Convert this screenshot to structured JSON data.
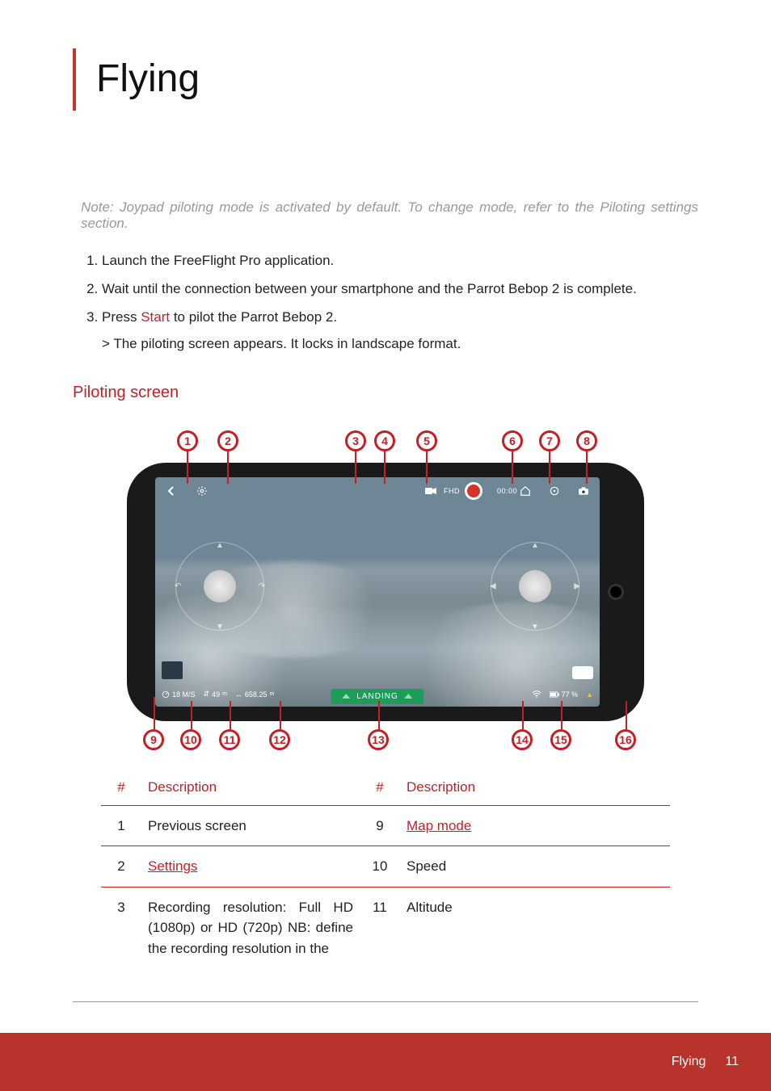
{
  "title": "Flying",
  "note": "Note: Joypad piloting mode is activated by default. To change mode, refer to the Piloting settings section.",
  "steps": {
    "s1": "Launch the FreeFlight Pro application.",
    "s2": "Wait until the connection between your smartphone and the Parrot Bebop 2 is complete.",
    "s3_prefix": "Press ",
    "s3_start": "Start",
    "s3_suffix": " to pilot the Parrot Bebop 2.",
    "s3b": "> The piloting screen appears. It locks in landscape format."
  },
  "section_heading": "Piloting screen",
  "topbar": {
    "fhd": "FHD",
    "timer": "00:00"
  },
  "bottombar": {
    "speed": "18 M/S",
    "alt_val": "49",
    "alt_unit": "m",
    "dist_val": "658.25",
    "dist_unit": "m",
    "landing": "LANDING",
    "batt": "77 %"
  },
  "callouts": [
    "1",
    "2",
    "3",
    "4",
    "5",
    "6",
    "7",
    "8",
    "9",
    "10",
    "11",
    "12",
    "13",
    "14",
    "15",
    "16"
  ],
  "table": {
    "h_num": "#",
    "h_desc": "Description",
    "rows_left": [
      {
        "n": "1",
        "d": "Previous screen",
        "link": false
      },
      {
        "n": "2",
        "d": "Settings",
        "link": true
      },
      {
        "n": "3",
        "d": "Recording resolution: Full HD (1080p) or HD (720p) NB: define the recording resolution in the",
        "link": false,
        "noborder": true
      }
    ],
    "rows_right": [
      {
        "n": "9",
        "d": "Map mode",
        "link": true
      },
      {
        "n": "10",
        "d": "Speed",
        "link": false
      },
      {
        "n": "11",
        "d": "Altitude",
        "link": false,
        "noborder": true
      }
    ]
  },
  "footer": {
    "section": "Flying",
    "page": "11"
  }
}
